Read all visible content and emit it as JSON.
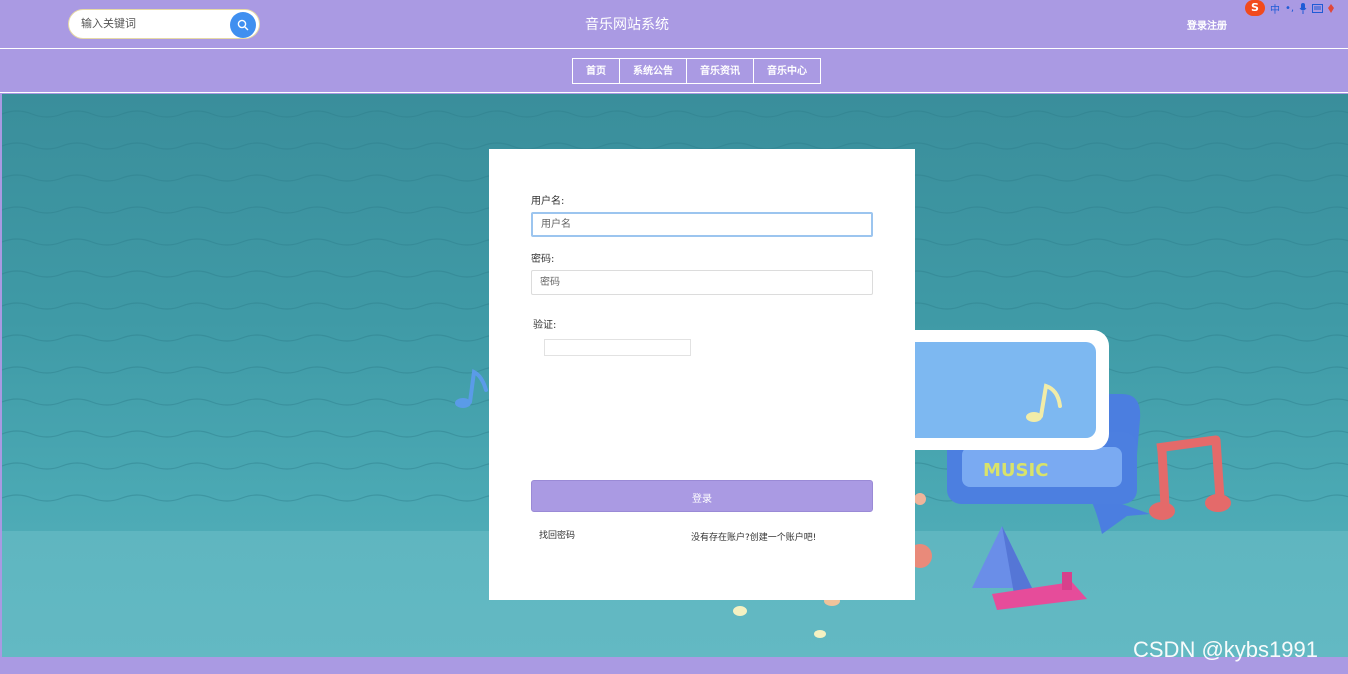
{
  "header": {
    "search_placeholder": "输入关键词",
    "site_title": "音乐网站系统",
    "login_register": "登录注册",
    "ime": {
      "logo": "S",
      "lang": "中"
    }
  },
  "nav": {
    "items": [
      {
        "label": "首页"
      },
      {
        "label": "系统公告"
      },
      {
        "label": "音乐资讯"
      },
      {
        "label": "音乐中心"
      }
    ]
  },
  "login_form": {
    "username_label": "用户名:",
    "username_placeholder": "用户名",
    "password_label": "密码:",
    "password_placeholder": "密码",
    "captcha_label": "验证:",
    "submit_label": "登录",
    "forgot_link": "找回密码",
    "register_link": "没有存在账户?创建一个账户吧!"
  },
  "background": {
    "banner_text": "MUSIC"
  },
  "watermark": "CSDN @kybs1991",
  "colors": {
    "theme": "#aa9ae3",
    "search_button": "#3f8ff0",
    "teal_bg": "#3f9aa6"
  }
}
